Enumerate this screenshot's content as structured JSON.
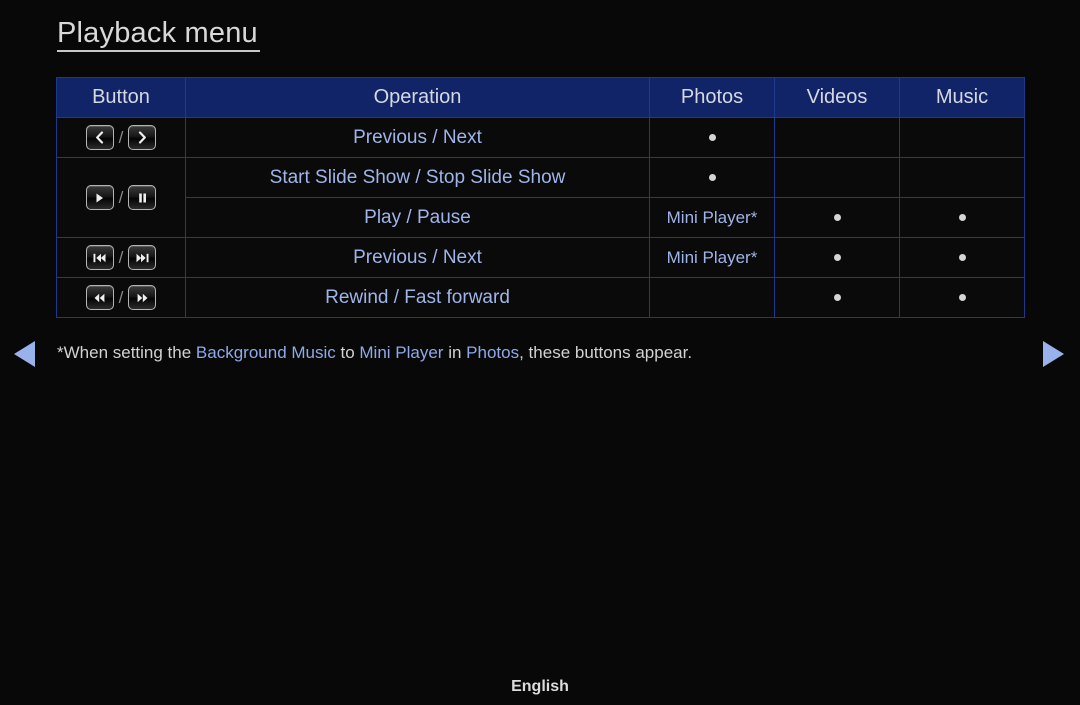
{
  "page": {
    "title": "Playback menu",
    "language": "English"
  },
  "table": {
    "headers": {
      "button": "Button",
      "operation": "Operation",
      "photos": "Photos",
      "videos": "Videos",
      "music": "Music"
    },
    "rows": [
      {
        "buttons": [
          "prev-chevron-icon",
          "next-chevron-icon"
        ],
        "separator": "/",
        "operation": "Previous / Next",
        "photos": "dot",
        "videos": "",
        "music": ""
      },
      {
        "buttons": [
          "play-icon",
          "pause-icon"
        ],
        "separator": "/",
        "operation": "Start Slide Show / Stop Slide Show",
        "photos": "dot",
        "videos": "",
        "music": ""
      },
      {
        "buttons": [],
        "separator": "",
        "operation": "Play / Pause",
        "photos": "Mini Player*",
        "videos": "dot",
        "music": "dot"
      },
      {
        "buttons": [
          "skip-previous-icon",
          "skip-next-icon"
        ],
        "separator": "/",
        "operation": "Previous / Next",
        "photos": "Mini Player*",
        "videos": "dot",
        "music": "dot"
      },
      {
        "buttons": [
          "rewind-icon",
          "fast-forward-icon"
        ],
        "separator": "/",
        "operation": "Rewind / Fast forward",
        "photos": "",
        "videos": "dot",
        "music": "dot"
      }
    ]
  },
  "footnote": {
    "part1": "*When setting the ",
    "term1": "Background Music",
    "part2": " to ",
    "term2": "Mini Player",
    "part3": " in ",
    "term3": "Photos",
    "part4": ", these buttons appear."
  },
  "navigation": {
    "prev": "previous-page-arrow",
    "next": "next-page-arrow"
  },
  "colors": {
    "header_background": "#122468",
    "table_border": "#1b3a8c",
    "operation_text": "#9fb4e8",
    "accent_arrow": "#9ab2ec",
    "page_background": "#080808"
  }
}
